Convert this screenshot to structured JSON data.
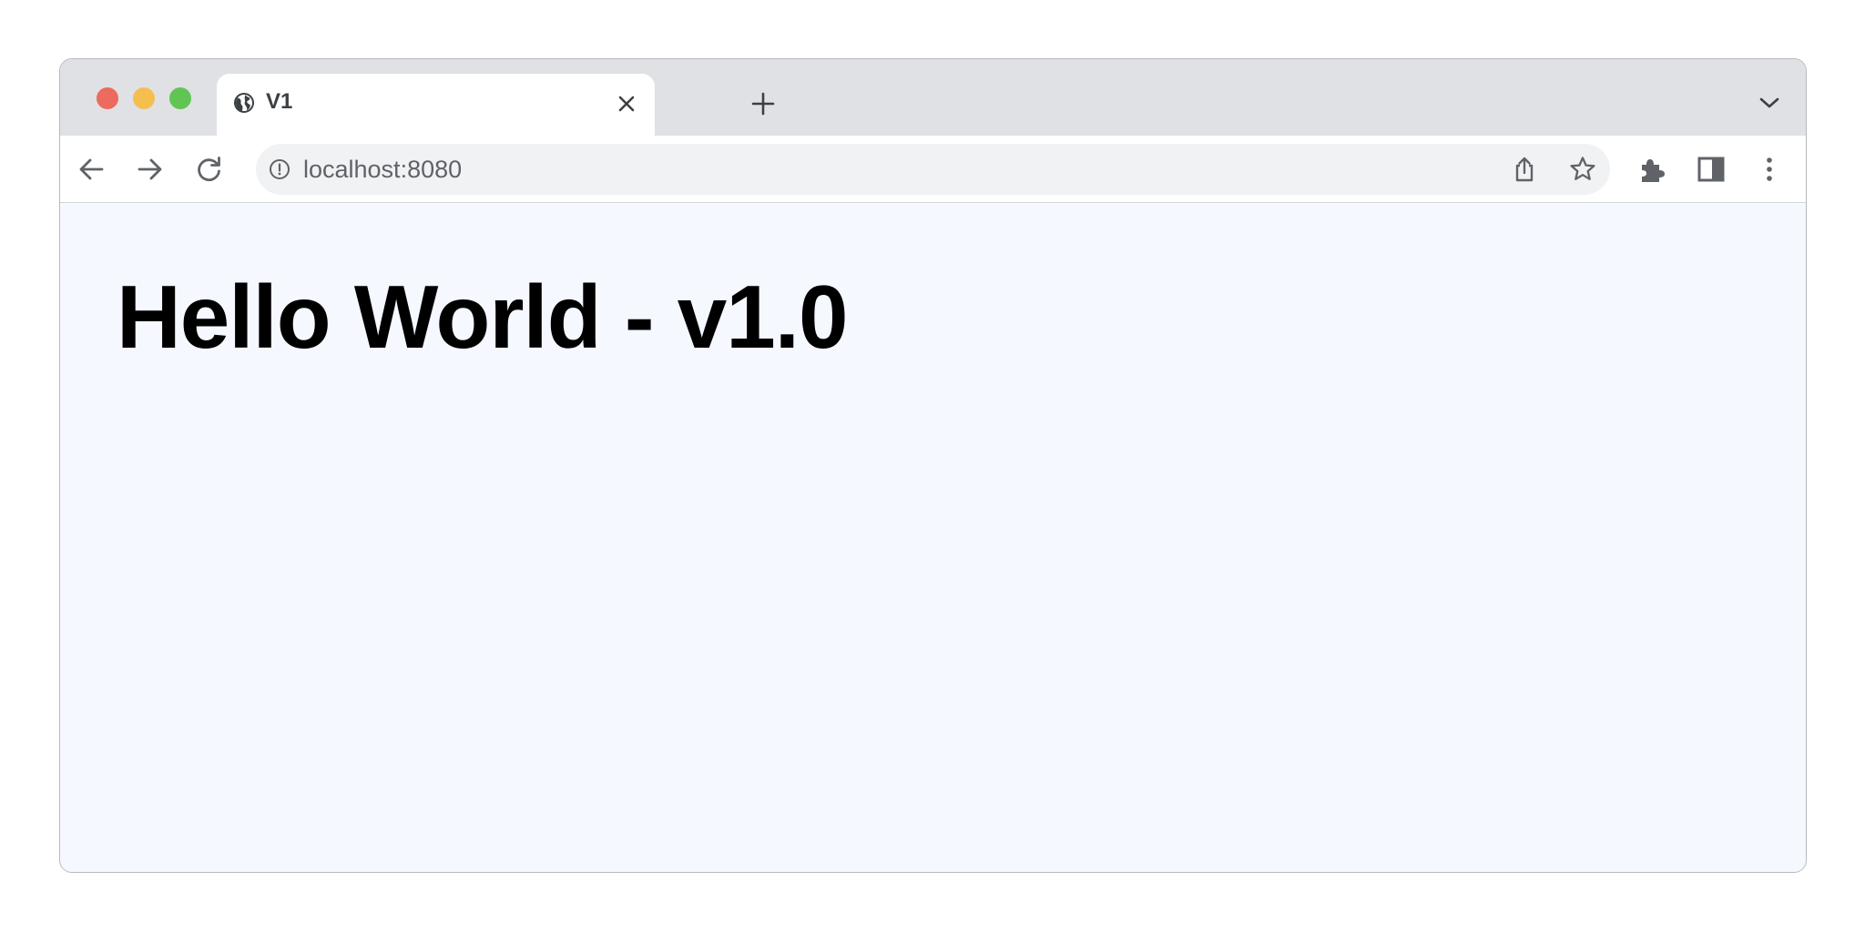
{
  "tab": {
    "title": "V1",
    "favicon": "globe-icon"
  },
  "address_bar": {
    "url": "localhost:8080",
    "security_icon": "info-icon"
  },
  "page": {
    "heading": "Hello World - v1.0"
  },
  "colors": {
    "traffic_red": "#ec6a5e",
    "traffic_yellow": "#f4bf4f",
    "traffic_green": "#61c554",
    "tabstrip_bg": "#dfe1e5",
    "page_bg": "#f5f8fe"
  }
}
